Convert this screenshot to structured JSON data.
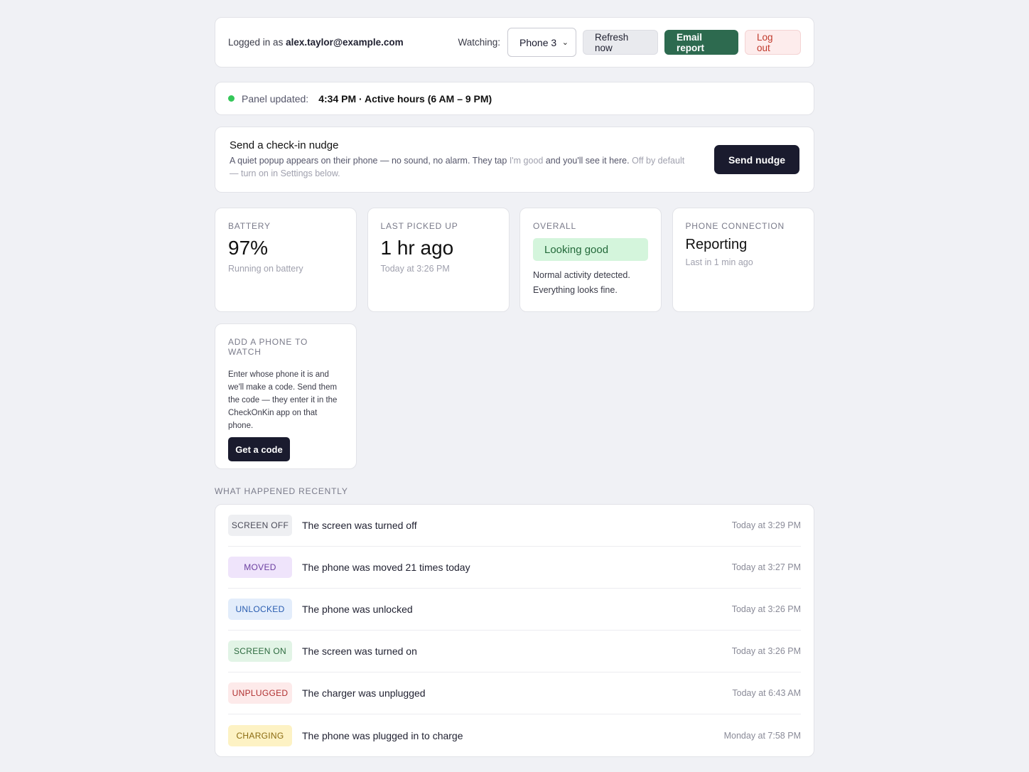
{
  "header": {
    "logged_in_prefix": "Logged in as",
    "user_email": "alex.taylor@example.com",
    "watching_label": "Watching:",
    "selected_phone": "Phone 3",
    "refresh_label": "Refresh now",
    "email_label": "Email report",
    "logout_label": "Log out"
  },
  "status": {
    "label": "Panel updated:",
    "value": "4:34 PM · Active hours (6 AM – 9 PM)",
    "dot_color": "#34c759"
  },
  "nudge": {
    "title": "Send a check-in nudge",
    "desc_1": "A quiet popup appears on their phone — no sound, no alarm. They tap",
    "desc_highlight": "I'm good",
    "desc_2": "and you'll see it here.",
    "desc_muted": "Off by default — turn on in Settings below.",
    "button_label": "Send nudge"
  },
  "stats": {
    "battery": {
      "heading": "Battery",
      "value": "97%",
      "sub": "Running on battery"
    },
    "picked": {
      "heading": "Last picked up",
      "value": "1 hr ago",
      "sub": "Today at 3:26 PM"
    },
    "overall": {
      "heading": "Overall",
      "pill": "Looking good",
      "desc": "Normal activity detected. Everything looks fine."
    },
    "connection": {
      "heading": "Phone connection",
      "value": "Reporting",
      "sub": "Last in 1 min ago"
    }
  },
  "add_phone": {
    "heading": "Add a phone to watch",
    "desc": "Enter whose phone it is and we'll make a code. Send them the code — they enter it in the CheckOnKin app on that phone.",
    "button_label": "Get a code"
  },
  "recent": {
    "title": "What happened recently",
    "events": [
      {
        "tag": "SCREEN OFF",
        "message": "The screen was turned off",
        "time": "Today at 3:29 PM",
        "bg": "#eeeff2",
        "fg": "#4a4b58"
      },
      {
        "tag": "MOVED",
        "message": "The phone was moved 21 times today",
        "time": "Today at 3:27 PM",
        "bg": "#efe4fb",
        "fg": "#6b3fa0"
      },
      {
        "tag": "UNLOCKED",
        "message": "The phone was unlocked",
        "time": "Today at 3:26 PM",
        "bg": "#e3edfb",
        "fg": "#2a5db0"
      },
      {
        "tag": "SCREEN ON",
        "message": "The screen was turned on",
        "time": "Today at 3:26 PM",
        "bg": "#e2f4e6",
        "fg": "#2d6a3f"
      },
      {
        "tag": "UNPLUGGED",
        "message": "The charger was unplugged",
        "time": "Today at 6:43 AM",
        "bg": "#fdeaea",
        "fg": "#b03030"
      },
      {
        "tag": "CHARGING",
        "message": "The phone was plugged in to charge",
        "time": "Monday at 7:58 PM",
        "bg": "#fdf2c4",
        "fg": "#8a6a10"
      }
    ]
  }
}
